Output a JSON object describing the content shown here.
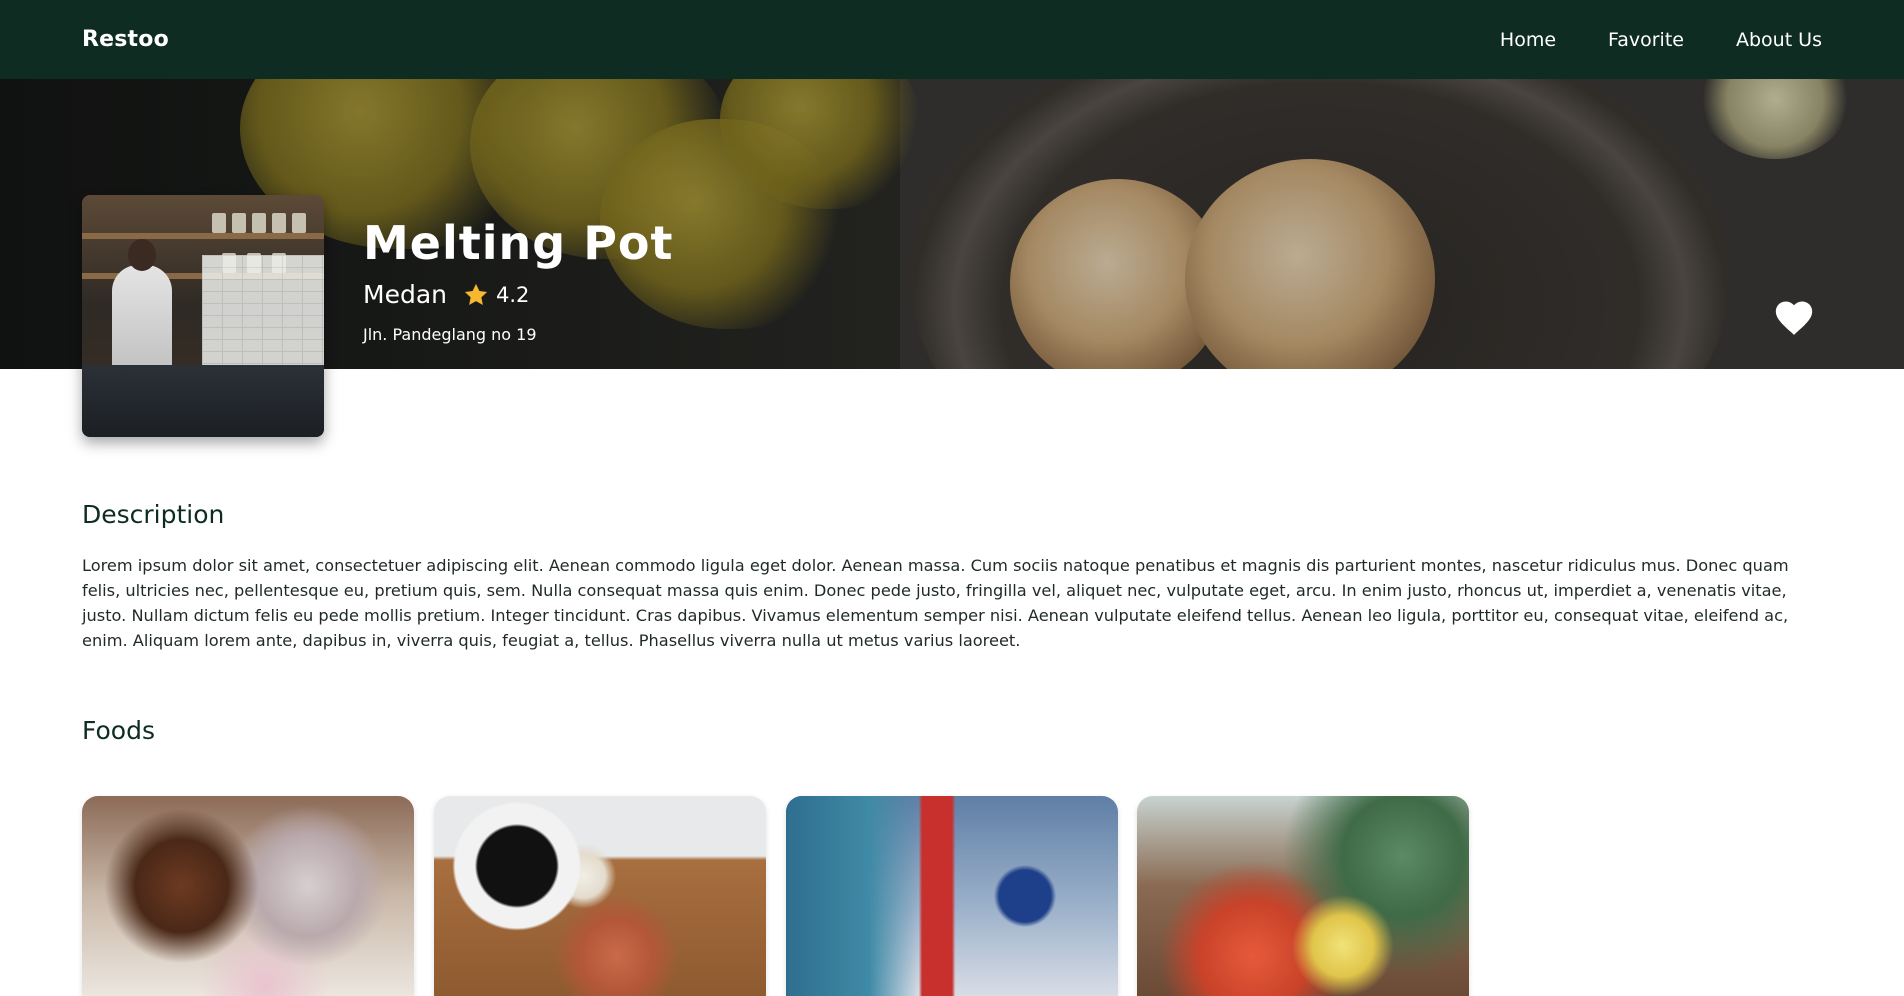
{
  "navbar": {
    "brand": "Restoo",
    "links": [
      {
        "label": "Home"
      },
      {
        "label": "Favorite"
      },
      {
        "label": "About Us"
      }
    ]
  },
  "restaurant": {
    "name": "Melting Pot",
    "city": "Medan",
    "rating": "4.2",
    "address": "Jln. Pandeglang no 19",
    "favorite_icon": "heart-icon",
    "rating_icon": "star-icon",
    "rating_color": "#f5b82e"
  },
  "description": {
    "title": "Description",
    "text": "Lorem ipsum dolor sit amet, consectetuer adipiscing elit. Aenean commodo ligula eget dolor. Aenean massa. Cum sociis natoque penatibus et magnis dis parturient montes, nascetur ridiculus mus. Donec quam felis, ultricies nec, pellentesque eu, pretium quis, sem. Nulla consequat massa quis enim. Donec pede justo, fringilla vel, aliquet nec, vulputate eget, arcu. In enim justo, rhoncus ut, imperdiet a, venenatis vitae, justo. Nullam dictum felis eu pede mollis pretium. Integer tincidunt. Cras dapibus. Vivamus elementum semper nisi. Aenean vulputate eleifend tellus. Aenean leo ligula, porttitor eu, consequat vitae, eleifend ac, enim. Aliquam lorem ante, dapibus in, viverra quis, feugiat a, tellus. Phasellus viverra nulla ut metus varius laoreet."
  },
  "foods": {
    "title": "Foods"
  },
  "colors": {
    "navbar": "#0e2c22",
    "heading": "#0e2c22",
    "text": "#1f2a26"
  }
}
